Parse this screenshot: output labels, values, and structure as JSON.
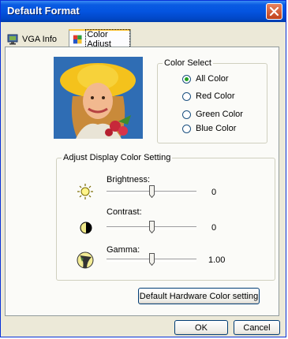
{
  "window": {
    "title": "Default Format"
  },
  "tabs": [
    {
      "label": "VGA Info",
      "icon": "monitor-icon",
      "active": false
    },
    {
      "label": "Color Adjust",
      "icon": "color-adjust-icon",
      "active": true
    }
  ],
  "color_select": {
    "legend": "Color Select",
    "options": [
      {
        "label": "All Color",
        "selected": true
      },
      {
        "label": "Red Color",
        "selected": false
      },
      {
        "label": "Green Color",
        "selected": false
      },
      {
        "label": "Blue Color",
        "selected": false
      }
    ]
  },
  "adjust": {
    "legend": "Adjust Display Color Setting",
    "sliders": [
      {
        "label": "Brightness:",
        "value": "0",
        "icon": "sun-icon",
        "level": 0.5
      },
      {
        "label": "Contrast:",
        "value": "0",
        "icon": "contrast-icon",
        "level": 0.5
      },
      {
        "label": "Gamma:",
        "value": "1.00",
        "icon": "gamma-icon",
        "level": 0.5
      }
    ]
  },
  "buttons": {
    "default_hardware": "Default Hardware Color setting",
    "ok": "OK",
    "cancel": "Cancel"
  },
  "colors": {
    "titlebar": "#0454e0",
    "close": "#d85b32",
    "tab_highlight": "#ffc83c",
    "radio_dot": "#21a121"
  }
}
